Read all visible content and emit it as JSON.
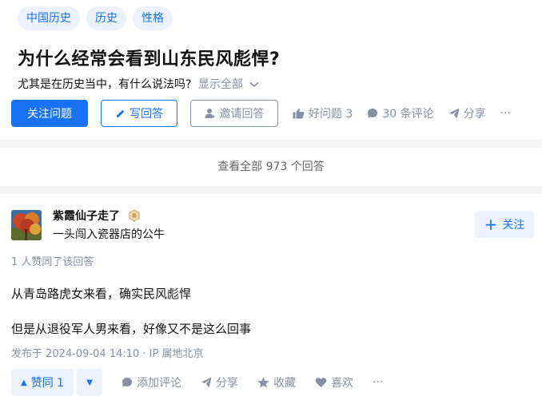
{
  "question": {
    "tags": [
      "中国历史",
      "历史",
      "性格"
    ],
    "title": "为什么经常会看到山东民风彪悍?",
    "description": "尤其是在历史当中，有什么说法吗?",
    "show_all": "显示全部",
    "actions": {
      "follow": "关注问题",
      "write": "写回答",
      "invite": "邀请回答",
      "good": "好问题 3",
      "comments": "30 条评论",
      "share": "分享",
      "more": "···"
    }
  },
  "view_all": "查看全部 973 个回答",
  "answer": {
    "author_name": "紫霞仙子走了",
    "author_bio": "一头闯入瓷器店的公牛",
    "follow": "关注",
    "voted_summary": "1 人赞同了该回答",
    "paragraphs": [
      "从青岛路虎女来看，确实民风彪悍",
      "但是从退役军人男来看，好像又不是这么回事"
    ],
    "published": "发布于 2024-09-04 14:10 · IP 属地北京",
    "actions": {
      "upvote": "赞同 1",
      "comment": "添加评论",
      "share": "分享",
      "collect": "收藏",
      "like": "喜欢",
      "more": "···"
    }
  },
  "colors": {
    "accent": "#1772f6",
    "accent_light": "#ebf2fe",
    "meta_grey": "#8590a6"
  }
}
